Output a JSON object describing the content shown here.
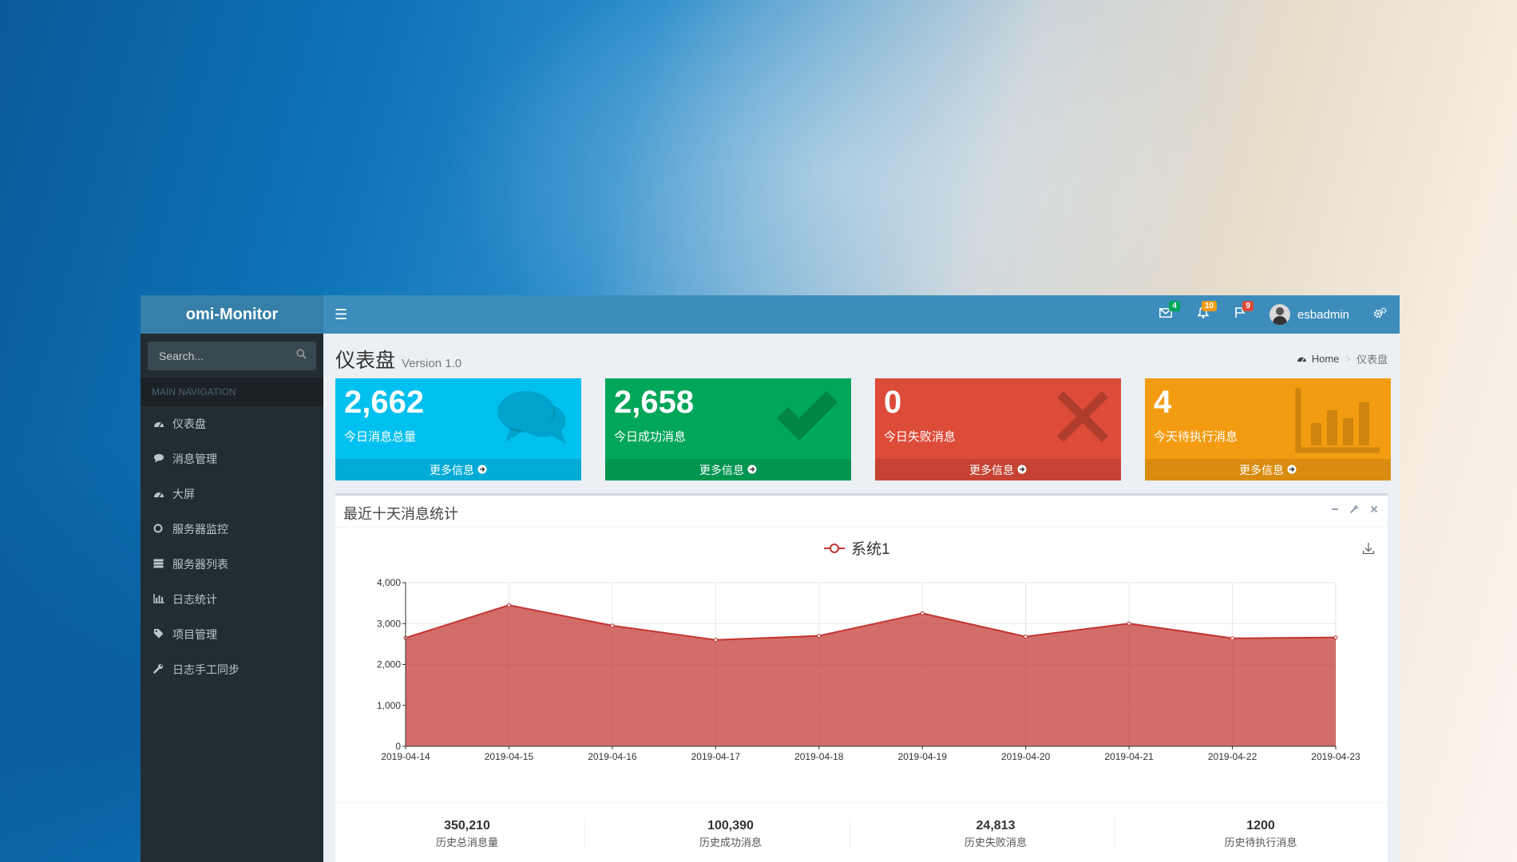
{
  "app": {
    "logo": "omi-Monitor"
  },
  "header": {
    "menu_icon": "hamburger-icon",
    "notifications": [
      {
        "icon": "envelope-icon",
        "count": "4",
        "color": "#00a65a"
      },
      {
        "icon": "bell-icon",
        "count": "10",
        "color": "#f39c12"
      },
      {
        "icon": "flag-icon",
        "count": "9",
        "color": "#dd4b39"
      }
    ],
    "user": "esbadmin",
    "settings_icon": "gears-icon"
  },
  "sidebar": {
    "search_placeholder": "Search...",
    "nav_header": "MAIN NAVIGATION",
    "items": [
      {
        "icon": "dashboard-icon",
        "label": "仪表盘"
      },
      {
        "icon": "comment-icon",
        "label": "消息管理"
      },
      {
        "icon": "dashboard-icon",
        "label": "大屏"
      },
      {
        "icon": "circle-icon",
        "label": "服务器监控"
      },
      {
        "icon": "server-icon",
        "label": "服务器列表"
      },
      {
        "icon": "bar-chart-icon",
        "label": "日志统计"
      },
      {
        "icon": "tag-icon",
        "label": "项目管理"
      },
      {
        "icon": "wrench-icon",
        "label": "日志手工同步"
      }
    ]
  },
  "page": {
    "title": "仪表盘",
    "version": "Version 1.0",
    "breadcrumb": {
      "home": "Home",
      "current": "仪表盘"
    }
  },
  "info_boxes": [
    {
      "value": "2,662",
      "label": "今日消息总量",
      "footer": "更多信息",
      "color": "#00c0ef",
      "icon": "comments-icon"
    },
    {
      "value": "2,658",
      "label": "今日成功消息",
      "footer": "更多信息",
      "color": "#00a65a",
      "icon": "check-icon"
    },
    {
      "value": "0",
      "label": "今日失败消息",
      "footer": "更多信息",
      "color": "#dd4b39",
      "icon": "times-icon"
    },
    {
      "value": "4",
      "label": "今天待执行消息",
      "footer": "更多信息",
      "color": "#f39c12",
      "icon": "bar-chart-icon"
    }
  ],
  "chart_box": {
    "title": "最近十天消息统计"
  },
  "chart_data": {
    "type": "area",
    "x": [
      "2019-04-14",
      "2019-04-15",
      "2019-04-16",
      "2019-04-17",
      "2019-04-18",
      "2019-04-19",
      "2019-04-20",
      "2019-04-21",
      "2019-04-22",
      "2019-04-23"
    ],
    "series": [
      {
        "name": "系统1",
        "values": [
          2650,
          3450,
          2950,
          2600,
          2700,
          3250,
          2680,
          3000,
          2640,
          2660
        ],
        "color": "#c23531"
      }
    ],
    "ylim": [
      0,
      4000
    ],
    "yticks": [
      "0",
      "1,000",
      "2,000",
      "3,000",
      "4,000"
    ],
    "legend": "top-center",
    "grid": true
  },
  "stats": [
    {
      "value": "350,210",
      "label": "历史总消息量"
    },
    {
      "value": "100,390",
      "label": "历史成功消息"
    },
    {
      "value": "24,813",
      "label": "历史失败消息"
    },
    {
      "value": "1200",
      "label": "历史待执行消息"
    }
  ]
}
